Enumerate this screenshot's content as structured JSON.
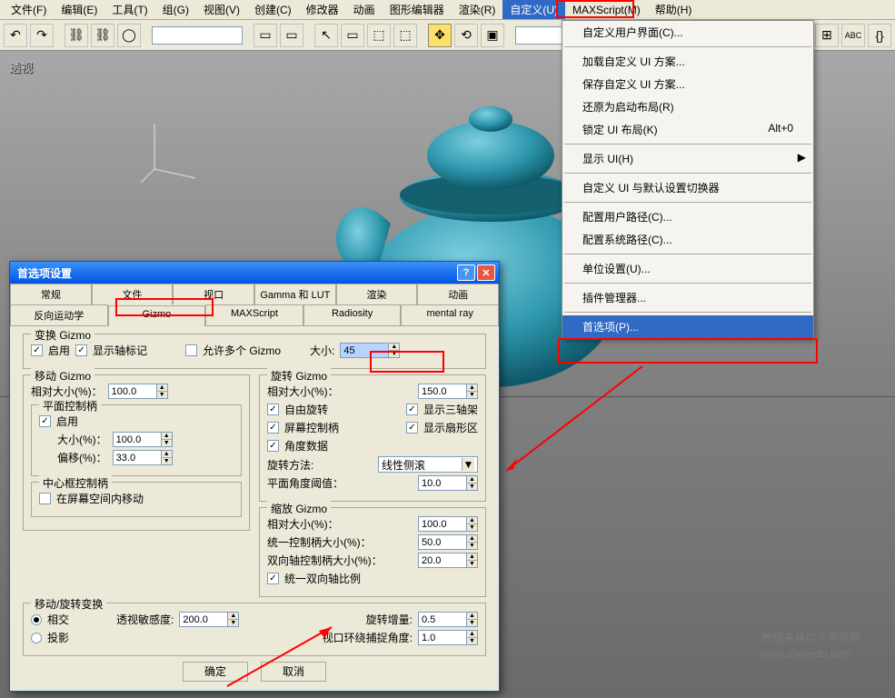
{
  "menubar": {
    "items": [
      {
        "label": "文件(F)"
      },
      {
        "label": "编辑(E)"
      },
      {
        "label": "工具(T)"
      },
      {
        "label": "组(G)"
      },
      {
        "label": "视图(V)"
      },
      {
        "label": "创建(C)"
      },
      {
        "label": "修改器"
      },
      {
        "label": "动画"
      },
      {
        "label": "图形编辑器"
      },
      {
        "label": "渲染(R)"
      },
      {
        "label": "自定义(U)",
        "highlighted": true
      },
      {
        "label": "MAXScript(M)"
      },
      {
        "label": "帮助(H)"
      }
    ]
  },
  "dropdown": {
    "items": [
      {
        "label": "自定义用户界面(C)..."
      },
      {
        "sep": true
      },
      {
        "label": "加载自定义 UI 方案..."
      },
      {
        "label": "保存自定义 UI 方案..."
      },
      {
        "label": "还原为启动布局(R)"
      },
      {
        "label": "锁定 UI 布局(K)",
        "shortcut": "Alt+0"
      },
      {
        "sep": true
      },
      {
        "label": "显示 UI(H)",
        "arrow": "▶"
      },
      {
        "sep": true
      },
      {
        "label": "自定义 UI 与默认设置切换器"
      },
      {
        "sep": true
      },
      {
        "label": "配置用户路径(C)..."
      },
      {
        "label": "配置系统路径(C)..."
      },
      {
        "sep": true
      },
      {
        "label": "单位设置(U)..."
      },
      {
        "sep": true
      },
      {
        "label": "插件管理器..."
      },
      {
        "sep": true
      },
      {
        "label": "首选项(P)...",
        "highlighted": true
      }
    ]
  },
  "viewport": {
    "label": "透视"
  },
  "dialog": {
    "title": "首选项设置",
    "tabs_row1": [
      "常规",
      "文件",
      "视口",
      "Gamma 和 LUT",
      "渲染",
      "动画"
    ],
    "tabs_row2": [
      "反向运动学",
      "Gizmo",
      "MAXScript",
      "Radiosity",
      "mental ray"
    ],
    "active_tab": "Gizmo",
    "transform_gizmo": {
      "legend": "变换 Gizmo",
      "enable_label": "启用",
      "show_axis_label": "显示轴标记",
      "allow_multi_label": "允许多个 Gizmo",
      "size_label": "大小:",
      "size_value": "45"
    },
    "move_gizmo": {
      "legend": "移动 Gizmo",
      "rel_label": "相对大小(%)：",
      "rel_value": "100.0",
      "plane_legend": "平面控制柄",
      "plane_enable_label": "启用",
      "sizepct_label": "大小(%)：",
      "sizepct_value": "100.0",
      "offset_label": "偏移(%)：",
      "offset_value": "33.0",
      "center_legend": "中心框控制柄",
      "center_check_label": "在屏幕空间内移动"
    },
    "rotate_gizmo": {
      "legend": "旋转 Gizmo",
      "rel_label": "相对大小(%)：",
      "rel_value": "150.0",
      "free_rotate_label": "自由旋转",
      "triax_label": "显示三轴架",
      "screen_handle_label": "屏幕控制柄",
      "sector_label": "显示扇形区",
      "angle_data_label": "角度数据",
      "method_label": "旋转方法:",
      "method_value": "线性侧滚",
      "threshold_label": "平面角度阈值：",
      "threshold_value": "10.0"
    },
    "scale_gizmo": {
      "legend": "缩放 Gizmo",
      "rel_label": "相对大小(%)：",
      "rel_value": "100.0",
      "uni_label": "统一控制柄大小(%)：",
      "uni_value": "50.0",
      "twoaxis_label": "双向轴控制柄大小(%)：",
      "twoaxis_value": "20.0",
      "uniform2_label": "统一双向轴比例"
    },
    "move_rotate": {
      "legend": "移动/旋转变换",
      "intersect_label": "相交",
      "project_label": "投影",
      "persp_label": "透视敏感度:",
      "persp_value": "200.0",
      "rot_inc_label": "旋转增量:",
      "rot_inc_value": "0.5",
      "vp_wrap_label": "视口环绕捕捉角度:",
      "vp_wrap_value": "1.0"
    },
    "ok_label": "确定",
    "cancel_label": "取消"
  },
  "toolbar_percent": "%",
  "watermark": {
    "line1": "教程来自以下学习网",
    "line2": "www.shejiedu.com"
  }
}
